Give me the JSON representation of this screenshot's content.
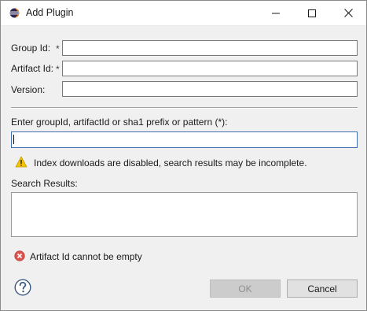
{
  "window": {
    "title": "Add Plugin",
    "icon": "eclipse-icon",
    "controls": [
      "minimize-icon",
      "maximize-icon",
      "close-icon"
    ]
  },
  "form": {
    "group_id": {
      "label": "Group Id:",
      "required_marker": "*",
      "value": ""
    },
    "artifact_id": {
      "label": "Artifact Id:",
      "required_marker": "*",
      "value": ""
    },
    "version": {
      "label": "Version:",
      "value": ""
    }
  },
  "search": {
    "label": "Enter groupId, artifactId or sha1 prefix or pattern (*):",
    "value": "",
    "warning_icon": "warning-icon",
    "warning": "Index downloads are disabled, search results may be incomplete.",
    "results_label": "Search Results:",
    "results": []
  },
  "status": {
    "error_icon": "error-icon",
    "error": "Artifact Id cannot be empty"
  },
  "footer": {
    "help_icon": "help-icon",
    "ok_label": "OK",
    "ok_enabled": false,
    "cancel_label": "Cancel"
  },
  "colors": {
    "warning": "#f5c400",
    "error": "#d9534f",
    "focus_border": "#3f6fb0"
  }
}
